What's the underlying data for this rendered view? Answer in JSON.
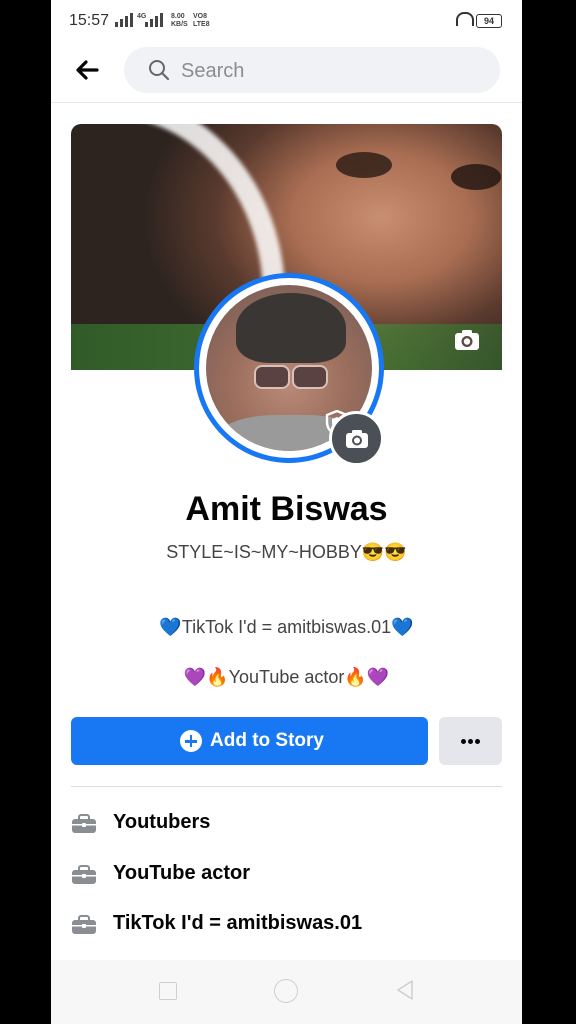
{
  "status_bar": {
    "time": "15:57",
    "net_label_1": "4G",
    "net_speed": "8.00",
    "net_speed_unit": "KB/S",
    "volte_1": "VO8",
    "volte_2": "LTE8",
    "battery": "94"
  },
  "header": {
    "search_placeholder": "Search"
  },
  "profile": {
    "name": "Amit Biswas",
    "tagline": "STYLE~IS~MY~HOBBY😎😎",
    "bio_line_1": "💙TikTok I'd = amitbiswas.01💙",
    "bio_line_2": "💜🔥YouTube actor🔥💜"
  },
  "actions": {
    "add_story_label": "Add to Story",
    "more_label": "•••"
  },
  "info_items": [
    {
      "icon": "briefcase-icon",
      "text": "Youtubers"
    },
    {
      "icon": "briefcase-icon",
      "text": "YouTube actor"
    },
    {
      "icon": "briefcase-icon",
      "text": "TikTok I'd = amitbiswas.01"
    }
  ],
  "colors": {
    "accent": "#1877f2",
    "secondary_button": "#e4e6eb",
    "search_bg": "#f0f2f5"
  }
}
